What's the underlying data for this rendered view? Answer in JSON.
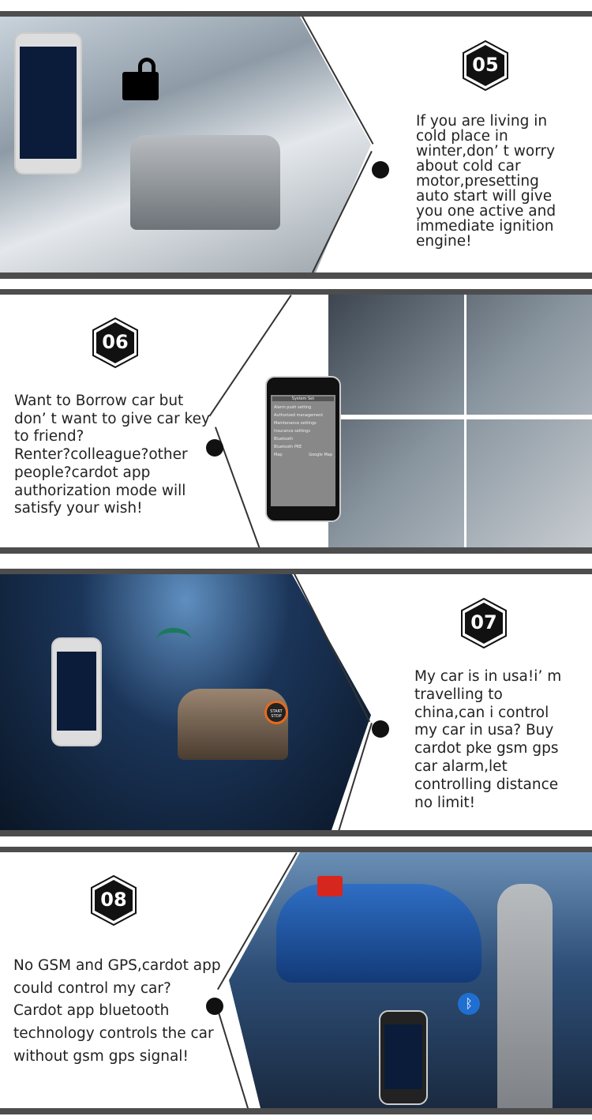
{
  "sections": [
    {
      "number": "05",
      "text": "If you are living in\ncold place in\nwinter,don’ t worry\nabout cold car\nmotor,presetting\nauto start will give\nyou one active and\nimmediate ignition\nengine!"
    },
    {
      "number": "06",
      "text": "Want to Borrow car but\ndon’ t want to give car key\nto friend?\nRenter?colleague?other\npeople?cardot app\nauthorization mode will\nsatisfy your wish!",
      "phone_screen": {
        "title": "System Set",
        "items": [
          "Alarm push setting",
          "Authorized management",
          "Maintenance settings",
          "Insurance settings",
          "Bluetooth",
          "Bluetooth PKE"
        ],
        "map_label": "Map",
        "map_value": "Google Map"
      }
    },
    {
      "number": "07",
      "text": "My car is in usa!i’ m\ntravelling to\nchina,can i control\nmy car in usa? Buy\ncardot pke gsm gps\ncar alarm,let\ncontrolling distance\nno limit!",
      "start_button": "START STOP"
    },
    {
      "number": "08",
      "text": "No GSM and GPS,cardot app\ncould control my car?\nCardot app bluetooth\ntechnology controls the car\nwithout gsm gps signal!"
    }
  ],
  "colors": {
    "bar": "#4d4d4d",
    "badge": "#111111",
    "lock_red": "#d7261e"
  }
}
